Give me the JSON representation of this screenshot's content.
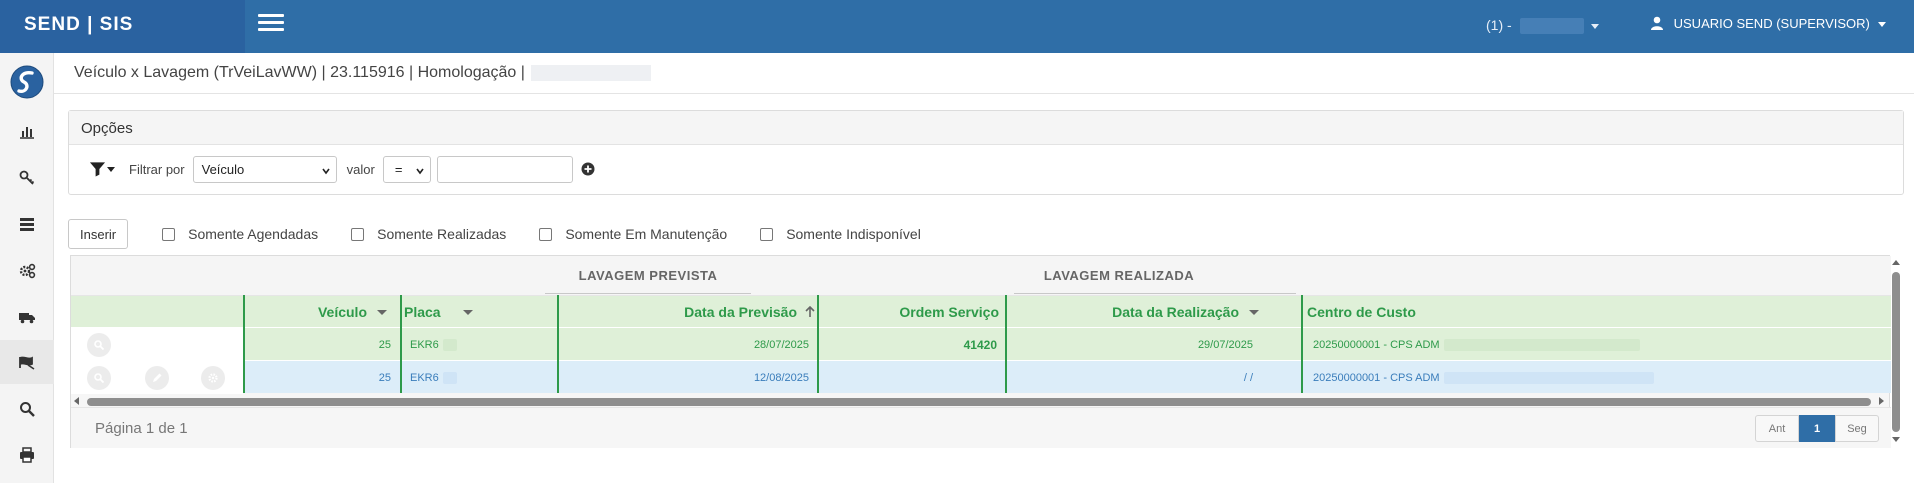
{
  "app": {
    "brand": "SEND | SIS"
  },
  "topbar": {
    "company_label": "(1) -",
    "user_label": "USUARIO SEND (SUPERVISOR)"
  },
  "sidebar": {
    "items": [
      {
        "icon": "bar-chart-icon"
      },
      {
        "icon": "key-icon"
      },
      {
        "icon": "server-icon"
      },
      {
        "icon": "cogs-icon"
      },
      {
        "icon": "truck-icon"
      },
      {
        "icon": "car-wash-icon"
      },
      {
        "icon": "search-icon"
      },
      {
        "icon": "print-icon"
      }
    ]
  },
  "page": {
    "title": "Veículo x Lavagem (TrVeiLavWW) | 23.115916 | Homologação |"
  },
  "options": {
    "title": "Opções",
    "filter_label": "Filtrar por",
    "filter_field": "Veículo",
    "value_label": "valor",
    "operator": "=",
    "value": ""
  },
  "toolbar": {
    "insert_label": "Inserir",
    "checks": [
      "Somente Agendadas",
      "Somente Realizadas",
      "Somente Em Manutenção",
      "Somente Indisponível"
    ]
  },
  "grid": {
    "groups": [
      "LAVAGEM PREVISTA",
      "LAVAGEM REALIZADA"
    ],
    "columns": [
      "Veículo",
      "Placa",
      "Data da Previsão",
      "Ordem Serviço",
      "Data da Realização",
      "Centro de Custo"
    ],
    "rows": [
      {
        "veiculo": "25",
        "placa": "EKR6",
        "previsao": "28/07/2025",
        "ordem": "41420",
        "realizacao": "29/07/2025",
        "centro": "20250000001 - CPS ADM"
      },
      {
        "veiculo": "25",
        "placa": "EKR6",
        "previsao": "12/08/2025",
        "ordem": "",
        "realizacao": "/ /",
        "centro": "20250000001 - CPS ADM"
      }
    ],
    "footer": {
      "page_info": "Página 1 de 1",
      "prev": "Ant",
      "current": "1",
      "next": "Seg"
    }
  }
}
